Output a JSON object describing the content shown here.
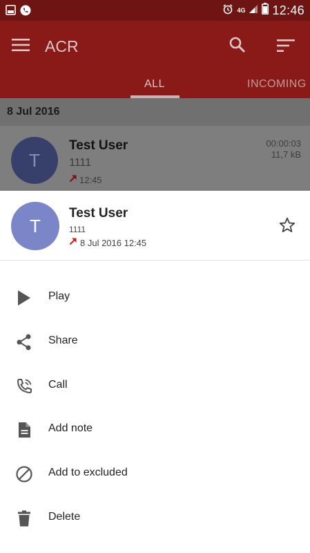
{
  "status_bar": {
    "time": "12:46",
    "network": "4G",
    "icons": [
      "image-icon",
      "phone-icon",
      "alarm-icon",
      "network-4g-icon",
      "signal-icon",
      "battery-icon"
    ]
  },
  "toolbar": {
    "title": "ACR",
    "icons": [
      "menu-icon",
      "search-icon",
      "sort-icon"
    ]
  },
  "tabs": [
    {
      "label": "ALL",
      "selected": true
    },
    {
      "label": "INCOMING",
      "selected": false
    }
  ],
  "list": {
    "date_header": "8 Jul 2016",
    "rows": [
      {
        "avatar_letter": "T",
        "name": "Test User",
        "number": "1111",
        "time": "12:45",
        "duration": "00:00:03",
        "size": "11,7 kB",
        "direction_icon": "outgoing-call-arrow-icon"
      }
    ]
  },
  "sheet": {
    "avatar_letter": "T",
    "name": "Test User",
    "number": "1111",
    "datetime": "8 Jul 2016 12:45",
    "star_icon": "star-outline-icon",
    "items": [
      {
        "label": "Play",
        "icon": "play-icon"
      },
      {
        "label": "Share",
        "icon": "share-icon"
      },
      {
        "label": "Call",
        "icon": "phone-call-icon"
      },
      {
        "label": "Add note",
        "icon": "note-icon"
      },
      {
        "label": "Add to excluded",
        "icon": "block-icon"
      },
      {
        "label": "Delete",
        "icon": "trash-icon"
      }
    ]
  },
  "colors": {
    "status_bar": "#6e1413",
    "toolbar_dimmed": "#8a1a18",
    "avatar_sheet": "#7b86c9",
    "outgoing_arrow": "#d01a1a"
  }
}
